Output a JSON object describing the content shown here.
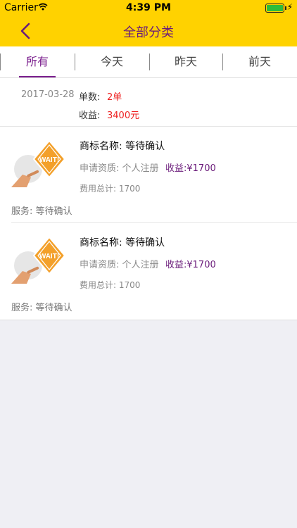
{
  "status": {
    "carrier": "Carrier",
    "time": "4:39 PM"
  },
  "nav": {
    "title": "全部分类"
  },
  "tabs": [
    {
      "label": "所有",
      "active": true
    },
    {
      "label": "今天",
      "active": false
    },
    {
      "label": "昨天",
      "active": false
    },
    {
      "label": "前天",
      "active": false
    }
  ],
  "summary": {
    "date": "2017-03-28",
    "count_label": "单数:",
    "count_value": "2单",
    "income_label": "收益:",
    "income_value": "3400元"
  },
  "orders": [
    {
      "name": "商标名称: 等待确认",
      "qualification": "申请资质: 个人注册",
      "income": "收益:¥1700",
      "fee": "费用总计: 1700",
      "service": "服务: 等待确认",
      "image_icon": "wait-sign-icon",
      "image_text": "WAIT!"
    },
    {
      "name": "商标名称: 等待确认",
      "qualification": "申请资质: 个人注册",
      "income": "收益:¥1700",
      "fee": "费用总计: 1700",
      "service": "服务: 等待确认",
      "image_icon": "wait-sign-icon",
      "image_text": "WAIT!"
    }
  ],
  "colors": {
    "accent": "#7b1f8e",
    "header": "#ffd200",
    "red": "#ee2222"
  }
}
